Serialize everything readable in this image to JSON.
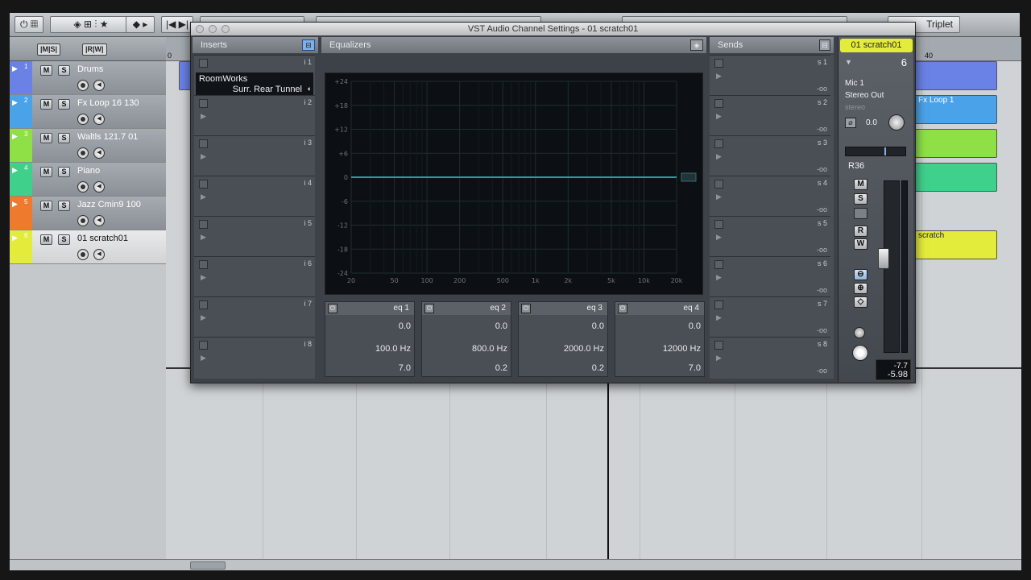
{
  "toolbar": {
    "record_label": "",
    "preset_label": "Triplet"
  },
  "tracklist": {
    "tracks": [
      {
        "num": "1",
        "name": "Drums",
        "color": "#6a82e6"
      },
      {
        "num": "2",
        "name": "Fx Loop 16 130",
        "color": "#4aa3e8"
      },
      {
        "num": "3",
        "name": "Waltls 121.7 01",
        "color": "#8ee046"
      },
      {
        "num": "4",
        "name": "Piano",
        "color": "#3fd18c"
      },
      {
        "num": "5",
        "name": "Jazz Cmin9 100",
        "color": "#ee7a2e"
      },
      {
        "num": "6",
        "name": "01 scratch01",
        "color": "#e4ec3b"
      }
    ],
    "mute_label": "M",
    "solo_label": "S"
  },
  "ruler": {
    "start_label": "0",
    "end_label": "40"
  },
  "parts": [
    {
      "name": "Fx Loop 1"
    },
    {
      "name": "scratch"
    }
  ],
  "vst": {
    "title": "VST Audio Channel Settings - 01 scratch01",
    "inserts_title": "Inserts",
    "equalizers_title": "Equalizers",
    "sends_title": "Sends",
    "plugin_name": "RoomWorks",
    "plugin_preset": "Surr. Rear Tunnel",
    "insert_slots": [
      "i 1",
      "i 2",
      "i 3",
      "i 4",
      "i 5",
      "i 6",
      "i 7",
      "i 8"
    ],
    "send_slots": [
      "s 1",
      "s 2",
      "s 3",
      "s 4",
      "s 5",
      "s 6",
      "s 7",
      "s 8"
    ],
    "send_value": "-oo",
    "eq_y_labels": [
      "+24",
      "+18",
      "+12",
      "+6",
      "0",
      "-6",
      "-12",
      "-18",
      "-24"
    ],
    "eq_x_labels": [
      "20",
      "50",
      "100",
      "200",
      "500",
      "1k",
      "2k",
      "5k",
      "10k",
      "20k"
    ],
    "eq_bands": [
      {
        "label": "eq 1",
        "gain": "0.0",
        "freq": "100.0 Hz",
        "q": "7.0"
      },
      {
        "label": "eq 2",
        "gain": "0.0",
        "freq": "800.0 Hz",
        "q": "0.2"
      },
      {
        "label": "eq 3",
        "gain": "0.0",
        "freq": "2000.0 Hz",
        "q": "0.2"
      },
      {
        "label": "eq 4",
        "gain": "0.0",
        "freq": "12000 Hz",
        "q": "7.0"
      }
    ]
  },
  "strip": {
    "name": "01 scratch01",
    "number": "6",
    "input": "Mic 1",
    "output": "Stereo Out",
    "config": "stereo",
    "gain": "0.0",
    "pan": "R36",
    "mute": "M",
    "solo": "S",
    "read": "R",
    "write": "W",
    "peak": "-7.7",
    "level": "-5.98",
    "accent": "#e4ec3b"
  }
}
